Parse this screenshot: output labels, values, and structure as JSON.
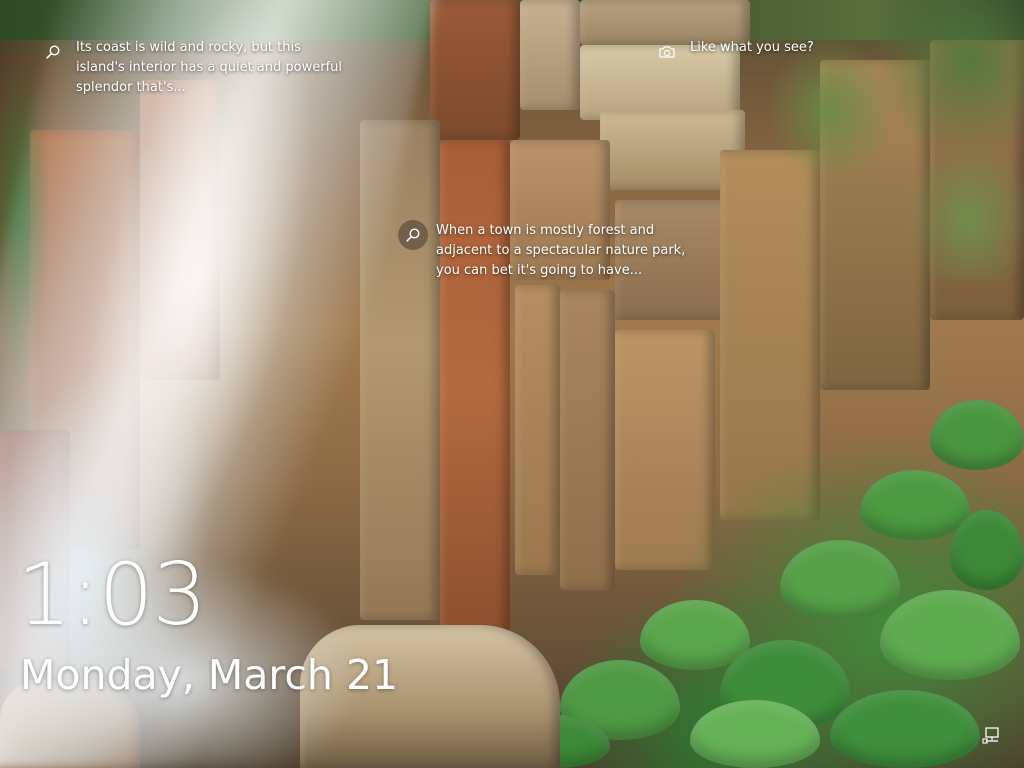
{
  "lock_screen": {
    "spotlight": {
      "hotspot_1": {
        "icon": "search-icon",
        "text": "Its coast is wild and rocky, but this\nisland's interior has a quiet and powerful\nsplendor that's..."
      },
      "camera_hotspot": {
        "icon": "camera-icon",
        "text": "Like what you see?"
      },
      "hotspot_2": {
        "icon": "search-icon",
        "text": "When a town is mostly forest and\nadjacent to a spectacular nature park,\nyou can bet it's going to have..."
      }
    },
    "clock": {
      "time": "1:03",
      "date": "Monday, March 21"
    },
    "status": {
      "network_icon": "network-wired-icon"
    }
  }
}
